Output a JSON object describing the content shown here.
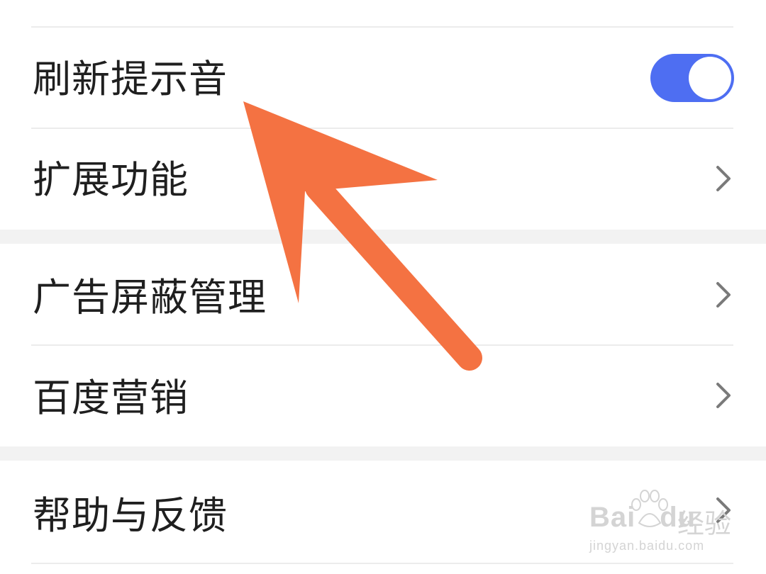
{
  "settings": {
    "items": [
      {
        "label": "刷新提示音",
        "type": "toggle",
        "toggle_on": true
      },
      {
        "label": "扩展功能",
        "type": "link"
      },
      {
        "label": "广告屏蔽管理",
        "type": "link"
      },
      {
        "label": "百度营销",
        "type": "link"
      },
      {
        "label": "帮助与反馈",
        "type": "link"
      }
    ]
  },
  "icons": {
    "chevron": "chevron-right-icon",
    "annotation": "arrow-annotation"
  },
  "colors": {
    "toggle_on": "#4e6ef2",
    "arrow": "#f47242",
    "text": "#1f1f1f",
    "section_gap": "#f2f2f2"
  },
  "watermark": {
    "brand": "Bai",
    "brand_suffix": "du",
    "service": "经验",
    "url": "jingyan.baidu.com"
  }
}
